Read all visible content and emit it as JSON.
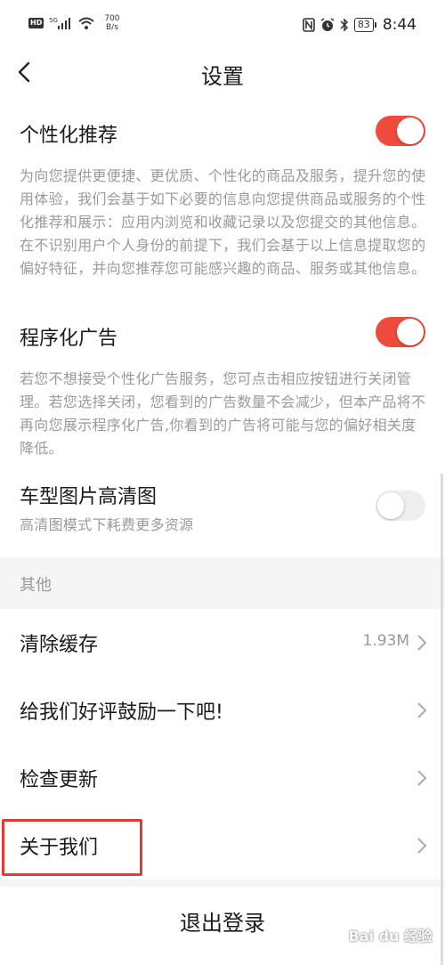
{
  "status_bar": {
    "hd": "HD",
    "signal": "5G",
    "net_speed_value": "700",
    "net_speed_unit": "B/s",
    "battery": "83",
    "time": "8:44"
  },
  "nav": {
    "title": "设置"
  },
  "personalized": {
    "title": "个性化推荐",
    "enabled": true,
    "desc": "为向您提供更便捷、更优质、个性化的商品及服务，提升您的使用体验，我们会基于如下必要的信息向您提供商品或服务的个性化推荐和展示：应用内浏览和收藏记录以及您提交的其他信息。在不识别用户个人身份的前提下，我们会基于以上信息提取您的偏好特征，并向您推荐您可能感兴趣的商品、服务或其他信息。"
  },
  "programmatic_ads": {
    "title": "程序化广告",
    "enabled": true,
    "desc": "若您不想接受个性化广告服务，您可点击相应按钮进行关闭管理。若您选择关闭，您看到的广告数量不会减少，但本产品将不再向您展示程序化广告,你看到的广告将可能与您的偏好相关度降低。"
  },
  "hd_images": {
    "title": "车型图片高清图",
    "desc": "高清图模式下耗费更多资源",
    "enabled": false
  },
  "other_section": {
    "label": "其他"
  },
  "list": [
    {
      "label": "清除缓存",
      "value": "1.93M"
    },
    {
      "label": "给我们好评鼓励一下吧!",
      "value": ""
    },
    {
      "label": "检查更新",
      "value": ""
    },
    {
      "label": "关于我们",
      "value": ""
    }
  ],
  "logout": {
    "label": "退出登录"
  },
  "watermark": {
    "text": "Bai du 经验"
  },
  "colors": {
    "accent": "#ee4b3c",
    "highlight": "#e53935"
  }
}
